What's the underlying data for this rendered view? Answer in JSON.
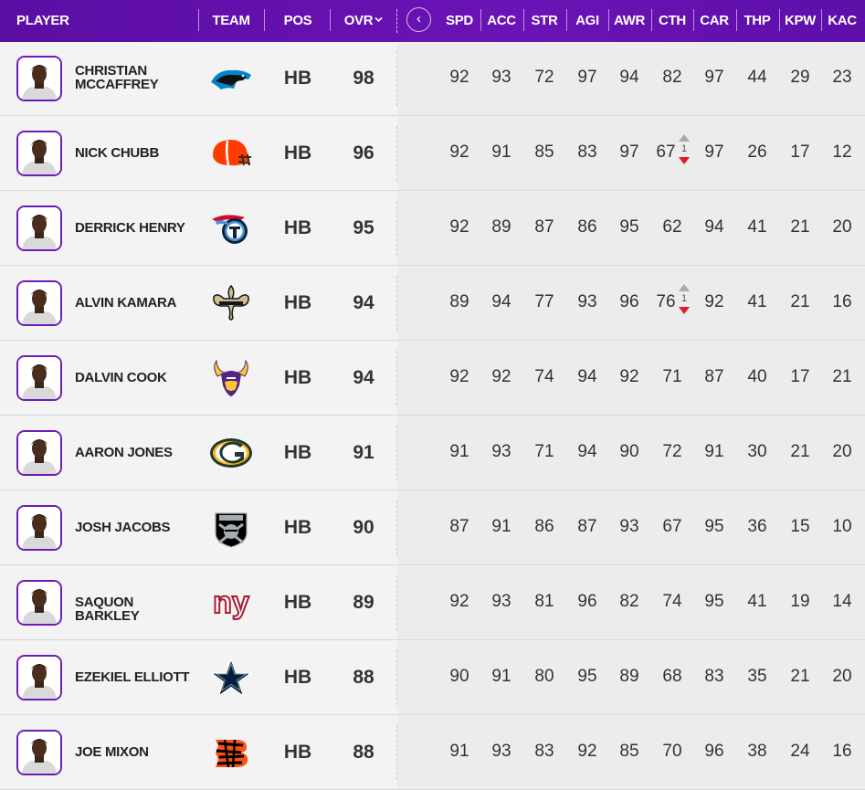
{
  "header": {
    "player": "PLAYER",
    "team": "TEAM",
    "pos": "POS",
    "ovr": "OVR",
    "back_icon": "chevron-left-icon",
    "stats": [
      "SPD",
      "ACC",
      "STR",
      "AGI",
      "AWR",
      "CTH",
      "CAR",
      "THP",
      "KPW",
      "KAC"
    ]
  },
  "colors": {
    "accent": "#6a13b6",
    "up_arrow": "#aaaaaa",
    "down_arrow": "#e0182d"
  },
  "players": [
    {
      "name": "Christian McCaffrey",
      "team_icon": "panthers-logo",
      "pos": "HB",
      "ovr": "98",
      "stats": [
        "92",
        "93",
        "72",
        "97",
        "94",
        "82",
        "97",
        "44",
        "29",
        "23"
      ]
    },
    {
      "name": "Nick Chubb",
      "team_icon": "browns-logo",
      "pos": "HB",
      "ovr": "96",
      "stats": [
        "92",
        "91",
        "85",
        "83",
        "97",
        "67",
        "97",
        "26",
        "17",
        "12"
      ],
      "change": {
        "stat": "CTH",
        "value": "1"
      }
    },
    {
      "name": "Derrick Henry",
      "team_icon": "titans-logo",
      "pos": "HB",
      "ovr": "95",
      "stats": [
        "92",
        "89",
        "87",
        "86",
        "95",
        "62",
        "94",
        "41",
        "21",
        "20"
      ]
    },
    {
      "name": "Alvin Kamara",
      "team_icon": "saints-logo",
      "pos": "HB",
      "ovr": "94",
      "stats": [
        "89",
        "94",
        "77",
        "93",
        "96",
        "76",
        "92",
        "41",
        "21",
        "16"
      ],
      "change": {
        "stat": "CTH",
        "value": "1"
      }
    },
    {
      "name": "Dalvin Cook",
      "team_icon": "vikings-logo",
      "pos": "HB",
      "ovr": "94",
      "stats": [
        "92",
        "92",
        "74",
        "94",
        "92",
        "71",
        "87",
        "40",
        "17",
        "21"
      ]
    },
    {
      "name": "Aaron Jones",
      "team_icon": "packers-logo",
      "pos": "HB",
      "ovr": "91",
      "stats": [
        "91",
        "93",
        "71",
        "94",
        "90",
        "72",
        "91",
        "30",
        "21",
        "20"
      ]
    },
    {
      "name": "Josh Jacobs",
      "team_icon": "raiders-logo",
      "pos": "HB",
      "ovr": "90",
      "stats": [
        "87",
        "91",
        "86",
        "87",
        "93",
        "67",
        "95",
        "36",
        "15",
        "10"
      ]
    },
    {
      "name": "Saquon Barkley",
      "team_icon": "giants-logo",
      "pos": "HB",
      "ovr": "89",
      "stats": [
        "92",
        "93",
        "81",
        "96",
        "82",
        "74",
        "95",
        "41",
        "19",
        "14"
      ],
      "logo_text": "ny"
    },
    {
      "name": "Ezekiel Elliott",
      "team_icon": "cowboys-logo",
      "pos": "HB",
      "ovr": "88",
      "stats": [
        "90",
        "91",
        "80",
        "95",
        "89",
        "68",
        "83",
        "35",
        "21",
        "20"
      ]
    },
    {
      "name": "Joe Mixon",
      "team_icon": "bengals-logo",
      "pos": "HB",
      "ovr": "88",
      "stats": [
        "91",
        "93",
        "83",
        "92",
        "85",
        "70",
        "96",
        "38",
        "24",
        "16"
      ]
    }
  ]
}
